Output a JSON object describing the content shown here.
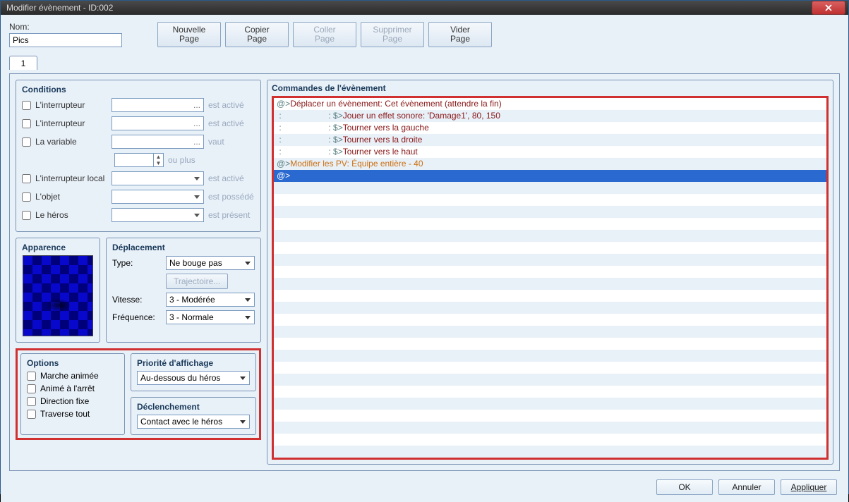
{
  "window": {
    "title": "Modifier évènement - ID:002"
  },
  "name": {
    "label": "Nom:",
    "value": "Pics"
  },
  "pageButtons": {
    "new": "Nouvelle\nPage",
    "copy": "Copier\nPage",
    "paste": "Coller\nPage",
    "delete": "Supprimer\nPage",
    "clear": "Vider\nPage"
  },
  "tabs": [
    "1"
  ],
  "conditions": {
    "title": "Conditions",
    "rows": [
      {
        "label": "L'interrupteur",
        "field": "...",
        "post": "est activé",
        "type": "pick"
      },
      {
        "label": "L'interrupteur",
        "field": "...",
        "post": "est activé",
        "type": "pick"
      },
      {
        "label": "La variable",
        "field": "...",
        "post": "vaut",
        "type": "pick"
      },
      {
        "label": "",
        "field": "",
        "post": "ou plus",
        "type": "spinner"
      },
      {
        "label": "L'interrupteur local",
        "field": "",
        "post": "est activé",
        "type": "dd"
      },
      {
        "label": "L'objet",
        "field": "",
        "post": "est possédé",
        "type": "dd"
      },
      {
        "label": "Le héros",
        "field": "",
        "post": "est présent",
        "type": "dd"
      }
    ]
  },
  "appearance": {
    "title": "Apparence"
  },
  "movement": {
    "title": "Déplacement",
    "type_label": "Type:",
    "type_value": "Ne bouge pas",
    "trajectory": "Trajectoire...",
    "speed_label": "Vitesse:",
    "speed_value": "3 - Modérée",
    "freq_label": "Fréquence:",
    "freq_value": "3 - Normale"
  },
  "options": {
    "title": "Options",
    "items": [
      "Marche animée",
      "Animé à l'arrêt",
      "Direction fixe",
      "Traverse tout"
    ]
  },
  "priority": {
    "title": "Priorité d'affichage",
    "value": "Au-dessous du héros"
  },
  "trigger": {
    "title": "Déclenchement",
    "value": "Contact avec le héros"
  },
  "commands": {
    "title": "Commandes de l'évènement",
    "lines": [
      {
        "pre": "@>",
        "text": "Déplacer un évènement: Cet évènement (attendre la fin)",
        "cls": "txt-red"
      },
      {
        "pre": " :                    : $>",
        "text": "Jouer un effet sonore: 'Damage1', 80, 150",
        "cls": "txt-red"
      },
      {
        "pre": " :                    : $>",
        "text": "Tourner vers la gauche",
        "cls": "txt-red"
      },
      {
        "pre": " :                    : $>",
        "text": "Tourner vers la droite",
        "cls": "txt-red"
      },
      {
        "pre": " :                    : $>",
        "text": "Tourner vers le haut",
        "cls": "txt-red"
      },
      {
        "pre": "@>",
        "text": "Modifier les PV: Équipe entière - 40",
        "cls": "txt-orange"
      },
      {
        "pre": "@>",
        "text": "",
        "cls": "txt-selblue",
        "sel": true
      }
    ]
  },
  "footer": {
    "ok": "OK",
    "cancel": "Annuler",
    "apply": "Appliquer"
  }
}
